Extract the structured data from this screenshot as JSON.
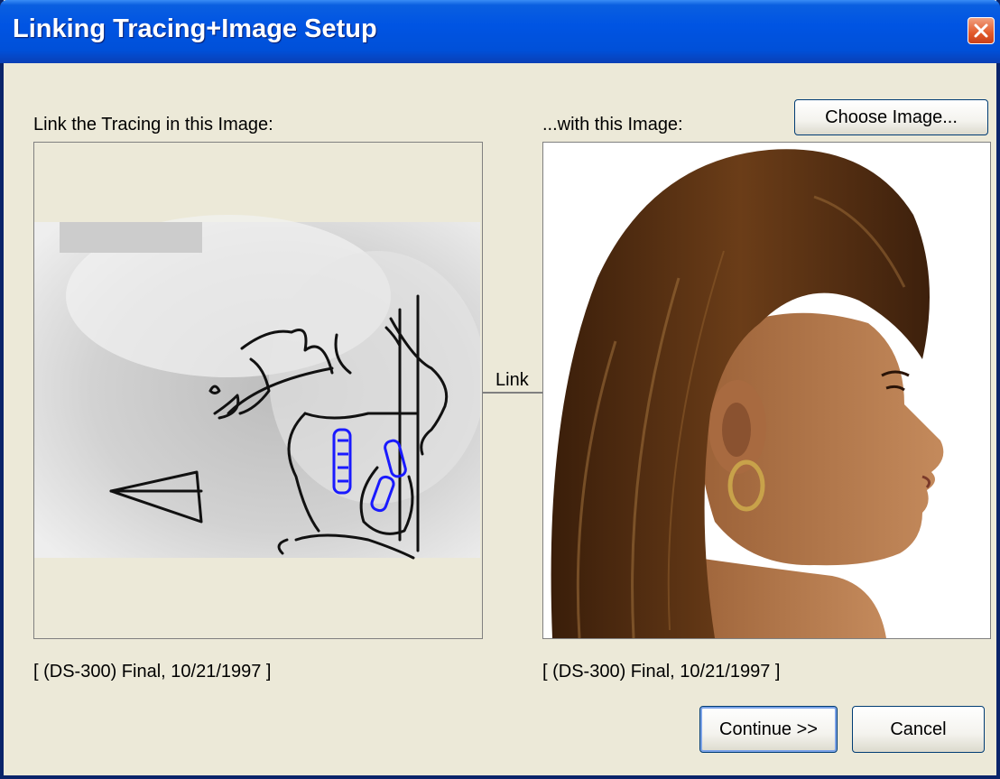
{
  "window": {
    "title": "Linking Tracing+Image Setup"
  },
  "left_panel": {
    "heading": "Link the Tracing in this Image:",
    "caption": "[ (DS-300) Final, 10/21/1997 ]"
  },
  "right_panel": {
    "heading": "...with this Image:",
    "caption": "[ (DS-300) Final, 10/21/1997 ]",
    "choose_label": "Choose Image..."
  },
  "link_label": "Link",
  "buttons": {
    "continue": "Continue >>",
    "cancel": "Cancel"
  },
  "icons": {
    "close": "close-icon"
  },
  "colors": {
    "titlebar": "#0054e3",
    "dialog_bg": "#ece9d8",
    "close": "#e25a2a",
    "tracing_teeth": "#1a1aff"
  }
}
